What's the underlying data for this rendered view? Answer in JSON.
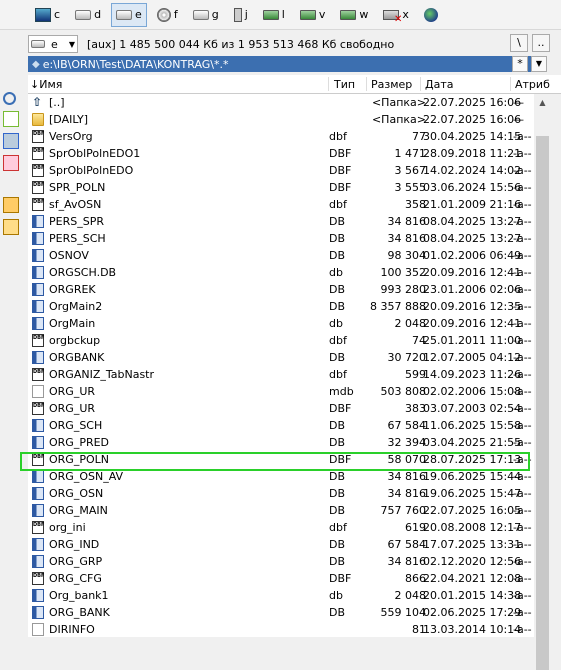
{
  "drives": [
    {
      "letter": "c",
      "icon": "windows-drive-icon"
    },
    {
      "letter": "d",
      "icon": "hdd-icon"
    },
    {
      "letter": "e",
      "icon": "hdd-icon",
      "active": true
    },
    {
      "letter": "f",
      "icon": "cdrom-icon"
    },
    {
      "letter": "g",
      "icon": "hdd-icon"
    },
    {
      "letter": "j",
      "icon": "card-reader-icon"
    },
    {
      "letter": "l",
      "icon": "network-drive-icon"
    },
    {
      "letter": "v",
      "icon": "network-drive-icon"
    },
    {
      "letter": "w",
      "icon": "network-drive-icon"
    },
    {
      "letter": "x",
      "icon": "network-drive-disconnected-icon"
    },
    {
      "letter": "\\",
      "icon": "network-globe-icon"
    }
  ],
  "panel": {
    "drive_selected": "e",
    "free_space": "[aux]  1 485 500 044 Кб из 1 953 513 468 Кб свободно",
    "root_button": "\\",
    "parent_button": "..",
    "path": "e:\\IB\\ORN\\Test\\DATA\\KONTRAG\\*.*",
    "filter_button": "*",
    "history_button": "▼"
  },
  "columns": {
    "name": "↓Имя",
    "ext": "Тип",
    "size": "Размер",
    "date": "Дата",
    "attr": "Атриб"
  },
  "files": [
    {
      "name": "[..]",
      "ext": "",
      "size": "<Папка>",
      "date": "22.07.2025 16:06",
      "attr": "—",
      "icon": "up"
    },
    {
      "name": "[DAILY]",
      "ext": "",
      "size": "<Папка>",
      "date": "22.07.2025 16:06",
      "attr": "—",
      "icon": "folder"
    },
    {
      "name": "VersOrg",
      "ext": "dbf",
      "size": "77",
      "date": "30.04.2025 14:15",
      "attr": "-a--",
      "icon": "dbf"
    },
    {
      "name": "SprOblPolnEDO1",
      "ext": "DBF",
      "size": "1 471",
      "date": "28.09.2018 11:21",
      "attr": "-a--",
      "icon": "dbf"
    },
    {
      "name": "SprOblPolnEDO",
      "ext": "DBF",
      "size": "3 567",
      "date": "14.02.2024 14:02",
      "attr": "-a--",
      "icon": "dbf"
    },
    {
      "name": "SPR_POLN",
      "ext": "DBF",
      "size": "3 555",
      "date": "03.06.2024 15:56",
      "attr": "-a--",
      "icon": "dbf"
    },
    {
      "name": "sf_AvOSN",
      "ext": "dbf",
      "size": "358",
      "date": "21.01.2009 21:16",
      "attr": "-a--",
      "icon": "dbf"
    },
    {
      "name": "PERS_SPR",
      "ext": "DB",
      "size": "34 816",
      "date": "08.04.2025 13:27",
      "attr": "-a--",
      "icon": "db"
    },
    {
      "name": "PERS_SCH",
      "ext": "DB",
      "size": "34 816",
      "date": "08.04.2025 13:27",
      "attr": "-a--",
      "icon": "db"
    },
    {
      "name": "OSNOV",
      "ext": "DB",
      "size": "98 304",
      "date": "01.02.2006 06:49",
      "attr": "-a--",
      "icon": "db"
    },
    {
      "name": "ORGSCH.DB",
      "ext": "db",
      "size": "100 352",
      "date": "20.09.2016 12:41",
      "attr": "-a--",
      "icon": "db"
    },
    {
      "name": "ORGREK",
      "ext": "DB",
      "size": "993 280",
      "date": "23.01.2006 02:06",
      "attr": "-a--",
      "icon": "db"
    },
    {
      "name": "OrgMain2",
      "ext": "DB",
      "size": "8 357 888",
      "date": "20.09.2016 12:35",
      "attr": "-a--",
      "icon": "db"
    },
    {
      "name": "OrgMain",
      "ext": "db",
      "size": "2 048",
      "date": "20.09.2016 12:41",
      "attr": "-a--",
      "icon": "db"
    },
    {
      "name": "orgbckup",
      "ext": "dbf",
      "size": "74",
      "date": "25.01.2011 11:00",
      "attr": "-a--",
      "icon": "dbf"
    },
    {
      "name": "ORGBANK",
      "ext": "DB",
      "size": "30 720",
      "date": "12.07.2005 04:12",
      "attr": "-a--",
      "icon": "db"
    },
    {
      "name": "ORGANIZ_TabNastr",
      "ext": "dbf",
      "size": "599",
      "date": "14.09.2023 11:26",
      "attr": "-a--",
      "icon": "dbf"
    },
    {
      "name": "ORG_UR",
      "ext": "mdb",
      "size": "503 808",
      "date": "02.02.2006 15:08",
      "attr": "-a--",
      "icon": "plain"
    },
    {
      "name": "ORG_UR",
      "ext": "DBF",
      "size": "383",
      "date": "03.07.2003 02:54",
      "attr": "-a--",
      "icon": "dbf"
    },
    {
      "name": "ORG_SCH",
      "ext": "DB",
      "size": "67 584",
      "date": "11.06.2025 15:58",
      "attr": "-a--",
      "icon": "db"
    },
    {
      "name": "ORG_PRED",
      "ext": "DB",
      "size": "32 394",
      "date": "03.04.2025 21:55",
      "attr": "-a--",
      "icon": "db"
    },
    {
      "name": "ORG_POLN",
      "ext": "DBF",
      "size": "58 070",
      "date": "28.07.2025 17:13",
      "attr": "-a--",
      "icon": "dbf",
      "selected": true
    },
    {
      "name": "ORG_OSN_AV",
      "ext": "DB",
      "size": "34 816",
      "date": "19.06.2025 15:44",
      "attr": "-a--",
      "icon": "db"
    },
    {
      "name": "ORG_OSN",
      "ext": "DB",
      "size": "34 816",
      "date": "19.06.2025 15:47",
      "attr": "-a--",
      "icon": "db"
    },
    {
      "name": "ORG_MAIN",
      "ext": "DB",
      "size": "757 760",
      "date": "22.07.2025 16:05",
      "attr": "-a--",
      "icon": "db"
    },
    {
      "name": "org_ini",
      "ext": "dbf",
      "size": "619",
      "date": "20.08.2008 12:17",
      "attr": "-a--",
      "icon": "dbf"
    },
    {
      "name": "ORG_IND",
      "ext": "DB",
      "size": "67 584",
      "date": "17.07.2025 13:31",
      "attr": "-a--",
      "icon": "db"
    },
    {
      "name": "ORG_GRP",
      "ext": "DB",
      "size": "34 816",
      "date": "02.12.2020 12:56",
      "attr": "-a--",
      "icon": "db"
    },
    {
      "name": "ORG_CFG",
      "ext": "DBF",
      "size": "866",
      "date": "22.04.2021 12:08",
      "attr": "-a--",
      "icon": "dbf"
    },
    {
      "name": "Org_bank1",
      "ext": "db",
      "size": "2 048",
      "date": "20.01.2015 14:38",
      "attr": "-a--",
      "icon": "db"
    },
    {
      "name": "ORG_BANK",
      "ext": "DB",
      "size": "559 104",
      "date": "02.06.2025 17:29",
      "attr": "-a--",
      "icon": "db"
    },
    {
      "name": "DIRINFO",
      "ext": "",
      "size": "81",
      "date": "13.03.2014 10:14",
      "attr": "-a--",
      "icon": "plain"
    }
  ],
  "left_tools": [
    "search-icon",
    "view-icon",
    "copy-icon",
    "copy-remote-icon",
    "archive-icon",
    "new-folder-icon"
  ]
}
